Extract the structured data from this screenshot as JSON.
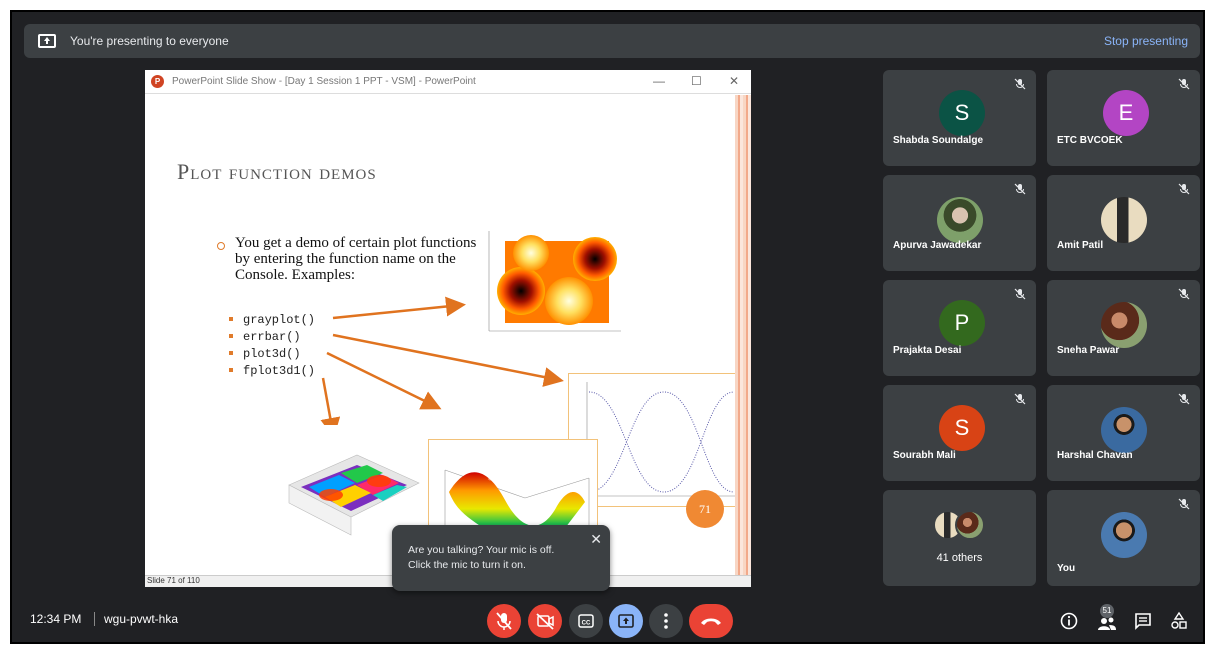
{
  "banner": {
    "message": "You're presenting to everyone",
    "stop_label": "Stop presenting"
  },
  "ppt_window": {
    "title": "PowerPoint Slide Show - [Day 1 Session 1 PPT - VSM] - PowerPoint",
    "status": "Slide 71 of 110"
  },
  "slide": {
    "title": "Plot function demos",
    "bullet": "You get a demo of certain plot functions by entering the function name on the Console. Examples:",
    "items": [
      "grayplot()",
      "errbar()",
      "plot3d()",
      "fplot3d1()"
    ],
    "page_number": "71"
  },
  "participants": [
    {
      "name": "Shabda Soundalge",
      "initial": "S",
      "color": "#0b5345",
      "muted": true
    },
    {
      "name": "ETC BVCOEK",
      "initial": "E",
      "color": "#b345c4",
      "muted": true
    },
    {
      "name": "Apurva Jawadekar",
      "initial": "",
      "color": "#6b8a5a",
      "muted": true
    },
    {
      "name": "Amit Patil",
      "initial": "",
      "color": "#d8c49a",
      "muted": true
    },
    {
      "name": "Prajakta Desai",
      "initial": "P",
      "color": "#33691e",
      "muted": true
    },
    {
      "name": "Sneha Pawar",
      "initial": "",
      "color": "#7a4a3a",
      "muted": true
    },
    {
      "name": "Sourabh Mali",
      "initial": "S",
      "color": "#d84315",
      "muted": true
    },
    {
      "name": "Harshal Chavan",
      "initial": "",
      "color": "#4a6a8a",
      "muted": true
    },
    {
      "name": "41 others",
      "initial": "",
      "color": "#8a6a5a",
      "muted": false
    },
    {
      "name": "You",
      "initial": "",
      "color": "#5a7aa0",
      "muted": true
    }
  ],
  "tooltip": {
    "line1": "Are you talking? Your mic is off.",
    "line2": "Click the mic to turn it on."
  },
  "bottom": {
    "time": "12:34 PM",
    "meeting_code": "wgu-pvwt-hka",
    "participant_count": "51"
  },
  "colors": {
    "background": "#202124",
    "tile": "#3c4043",
    "accent_blue": "#8ab4f8",
    "danger_red": "#ea4335",
    "slide_orange": "#f08933"
  }
}
